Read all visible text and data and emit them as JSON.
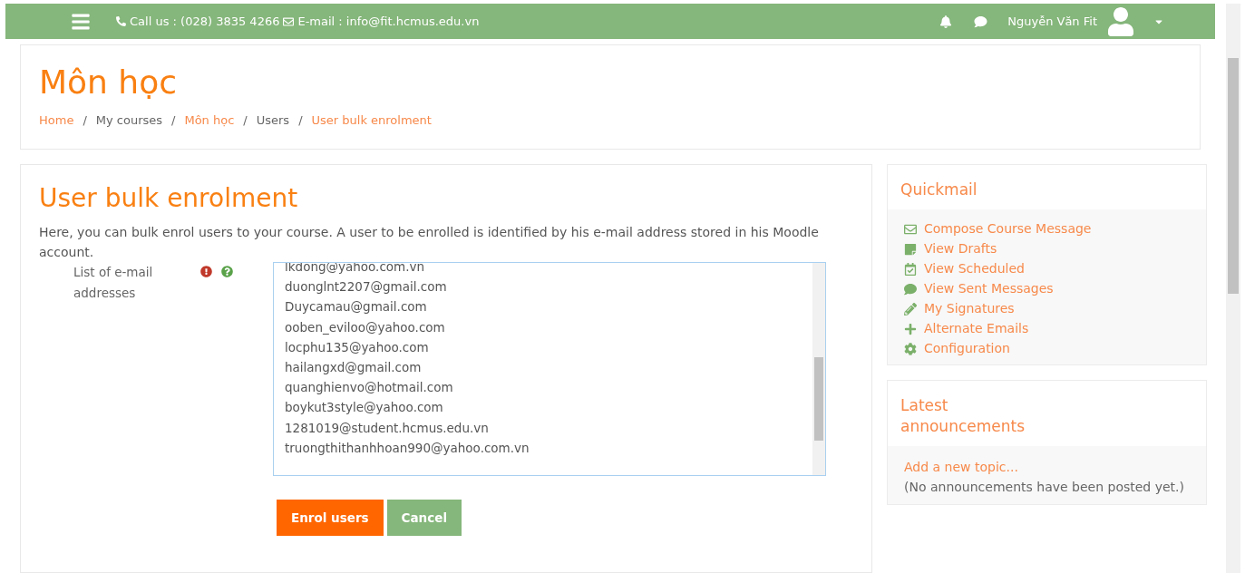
{
  "navbar": {
    "contact_phone": "Call us : (028) 3835 4266",
    "contact_email": "E-mail : info@fit.hcmus.edu.vn",
    "user_name": "Nguyễn Văn Fit"
  },
  "header": {
    "title": "Môn học",
    "separator": "/",
    "breadcrumbs": [
      {
        "label": "Home",
        "kind": "link"
      },
      {
        "label": "My courses",
        "kind": "text"
      },
      {
        "label": "Môn học",
        "kind": "link"
      },
      {
        "label": "Users",
        "kind": "text"
      },
      {
        "label": "User bulk enrolment",
        "kind": "link"
      }
    ]
  },
  "main": {
    "title": "User bulk enrolment",
    "description": "Here, you can bulk enrol users to your course. A user to be enrolled is identified by his e-mail address stored in his Moodle account.",
    "field_label": "List of e-mail addresses",
    "emails": [
      "lkdong@yahoo.com.vn",
      "duonglnt2207@gmail.com",
      "Duycamau@gmail.com",
      "ooben_eviloo@yahoo.com",
      "locphu135@yahoo.com",
      "hailangxd@gmail.com",
      "quanghienvo@hotmail.com",
      "boykut3style@yahoo.com",
      "1281019@student.hcmus.edu.vn",
      "truongthithanhhoan990@yahoo.com.vn"
    ],
    "buttons": [
      {
        "label": "Enrol users",
        "kind": "primary"
      },
      {
        "label": "Cancel",
        "kind": "secondary"
      }
    ]
  },
  "quickmail": {
    "title": "Quickmail",
    "items": [
      {
        "label": "Compose Course Message",
        "kind": "envelope"
      },
      {
        "label": "View Drafts",
        "kind": "note"
      },
      {
        "label": "View Scheduled",
        "kind": "calendar"
      },
      {
        "label": "View Sent Messages",
        "kind": "chat"
      },
      {
        "label": "My Signatures",
        "kind": "pencil"
      },
      {
        "label": "Alternate Emails",
        "kind": "plus"
      },
      {
        "label": "Configuration",
        "kind": "gear"
      }
    ]
  },
  "announcements": {
    "title": "Latest announcements",
    "add_link": "Add a new topic...",
    "note": "(No announcements have been posted yet.)"
  }
}
